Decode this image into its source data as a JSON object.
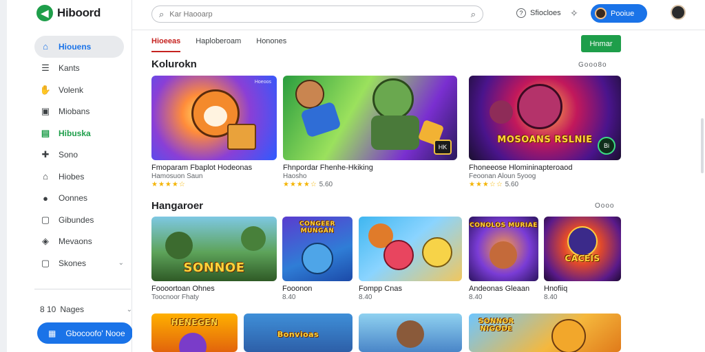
{
  "app": {
    "name": "Hiboord",
    "logo_glyph": "◀"
  },
  "sidebar": {
    "items": [
      {
        "label": "Hiouens",
        "icon": "home-icon",
        "glyph": "⌂",
        "active": true
      },
      {
        "label": "Kants",
        "icon": "list-icon",
        "glyph": "☰"
      },
      {
        "label": "Volenk",
        "icon": "hand-icon",
        "glyph": "✋"
      },
      {
        "label": "Miobans",
        "icon": "inbox-icon",
        "glyph": "▣"
      },
      {
        "label": "Hibuska",
        "icon": "shop-icon",
        "glyph": "▤",
        "highlight": true
      },
      {
        "label": "Sono",
        "icon": "puzzle-icon",
        "glyph": "✚"
      },
      {
        "label": "Hiobes",
        "icon": "house-icon",
        "glyph": "⌂"
      },
      {
        "label": "Oonnes",
        "icon": "circle-icon",
        "glyph": "●"
      },
      {
        "label": "Gibundes",
        "icon": "box-icon",
        "glyph": "▢"
      },
      {
        "label": "Mevaons",
        "icon": "tag-icon",
        "glyph": "◈"
      },
      {
        "label": "Skones",
        "icon": "square-icon",
        "glyph": "▢",
        "chevron": true
      }
    ],
    "extra": {
      "prefix": "8 10",
      "label": "Nages"
    },
    "cta": {
      "label": "Gbocoofo' Nooe",
      "icon": "calendar-icon",
      "glyph": "▦"
    }
  },
  "topbar": {
    "search_placeholder": "Kar Haooarp",
    "help_label": "Sfiocloes",
    "user_label": "Pooiue"
  },
  "main": {
    "tabs": [
      {
        "label": "Hioeeas",
        "active": true
      },
      {
        "label": "Haploberoam"
      },
      {
        "label": "Honones"
      }
    ],
    "action_button": "Hnmar",
    "section1": {
      "title": "Kolurokn",
      "more": "Gooo8o",
      "cards": [
        {
          "title": "Fmoparam Fbaplot Hodeonas",
          "sub_text": "Hamosuon Saun",
          "stars": "★★★★☆",
          "tag": "Hoeoos"
        },
        {
          "title": "Fhnpordar Fhenhe-Hkiking",
          "sub_text": "Haosho",
          "stars": "★★★★☆",
          "rating": "5.60",
          "badge": "HK"
        },
        {
          "title": "Fhoneeose Hlomininapteroaod",
          "sub_text": "Feoonan Aloun 5yoog",
          "stars": "★★★☆☆",
          "rating": "5.60",
          "overlay": "MOSOANS RSLNIE",
          "badge": "Bi"
        }
      ]
    },
    "section2": {
      "title": "Hangaroer",
      "more": "Oooo",
      "cards": [
        {
          "title": "Foooortoan Ohnes",
          "sub_text": "Toocnoor Fhaty",
          "overlay": "SONNOE"
        },
        {
          "title": "Fooonon",
          "sub_text": "8.40",
          "overlay": "CONGEER MUNGAN"
        },
        {
          "title": "Fompp Cnas",
          "sub_text": "8.40"
        },
        {
          "title": "Andeonas Gleaan",
          "sub_text": "8.40",
          "overlay": "CONOLOS MURIAE"
        },
        {
          "title": "Hnofiiq",
          "sub_text": "8.40",
          "overlay": "CACEIS"
        }
      ]
    },
    "section3": {
      "cards": [
        {
          "overlay": "HENEGEN"
        },
        {
          "overlay": "Bonvioas"
        },
        {
          "overlay": ""
        },
        {
          "overlay": "SONNOR NIGODE"
        }
      ]
    }
  }
}
